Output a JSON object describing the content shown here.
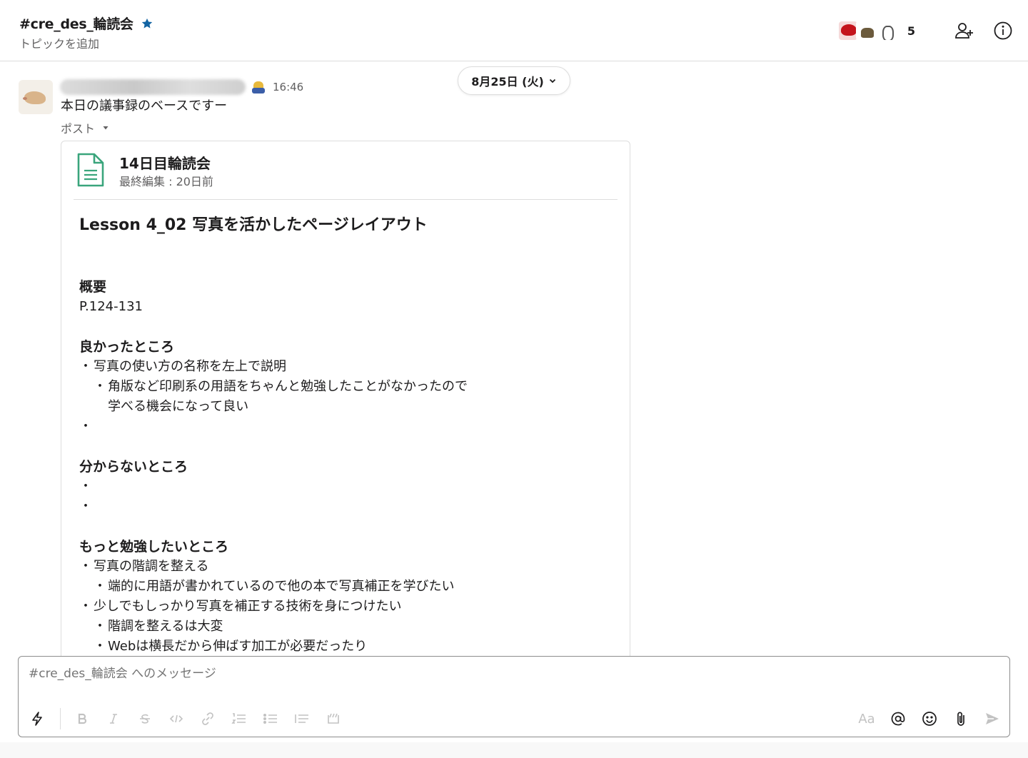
{
  "header": {
    "channel_name": "#cre_des_輪読会",
    "topic": "トピックを追加",
    "member_count": "5"
  },
  "date_pill": {
    "label": "8月25日 (火)"
  },
  "message": {
    "timestamp": "16:46",
    "text": "本日の議事録のベースですー",
    "post_label": "ポスト"
  },
  "post": {
    "title": "14日目輪読会",
    "last_edited": "最終編集 : 20日前",
    "heading": "Lesson 4_02 写真を活かしたページレイアウト",
    "section_overview": "概要",
    "pages": "P.124-131",
    "section_good": "良かったところ",
    "good_item_1": "写真の使い方の名称を左上で説明",
    "good_item_1_sub": "角版など印刷系の用語をちゃんと勉強したことがなかったので",
    "good_item_1_sub_cont": "学べる機会になって良い",
    "section_unclear": "分からないところ",
    "section_study": "もっと勉強したいところ",
    "study_item_1": "写真の階調を整える",
    "study_item_1_sub": "端的に用語が書かれているので他の本で写真補正を学びたい",
    "study_item_2": "少しでもしっかり写真を補正する技術を身につけたい",
    "study_item_2_sub_1": "階調を整えるは大変",
    "study_item_2_sub_2": "Webは横長だから伸ばす加工が必要だったり"
  },
  "composer": {
    "placeholder": "#cre_des_輪読会 へのメッセージ",
    "aa_label": "Aa"
  },
  "colors": {
    "star": "#1264a3",
    "doc_icon": "#3aa57c",
    "muted_text": "#616061",
    "toolbar_disabled": "#c2c2c2"
  },
  "icons": [
    "star-icon",
    "add-member-icon",
    "info-icon",
    "chevron-down-icon",
    "caret-down-icon",
    "document-icon",
    "shortcuts-icon",
    "bold-icon",
    "italic-icon",
    "strikethrough-icon",
    "code-icon",
    "link-icon",
    "ordered-list-icon",
    "bulleted-list-icon",
    "blockquote-icon",
    "code-block-icon",
    "mention-icon",
    "emoji-icon",
    "attachment-icon",
    "send-icon"
  ]
}
